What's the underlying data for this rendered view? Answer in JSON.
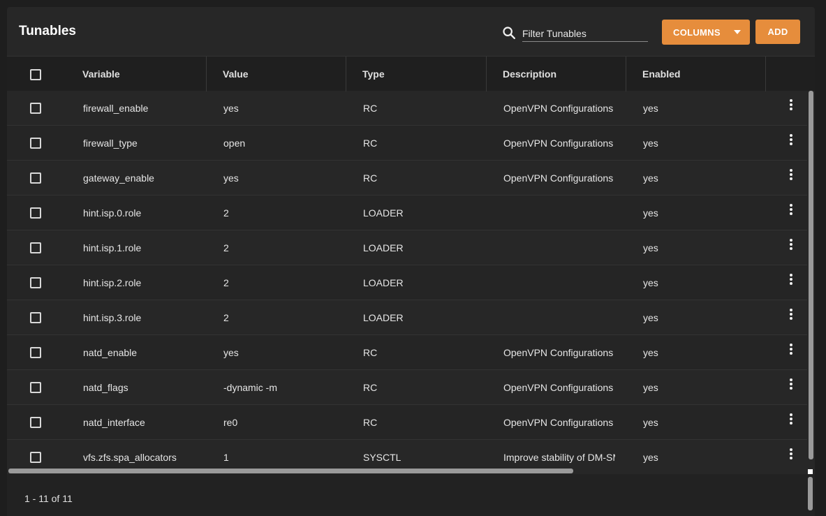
{
  "header": {
    "title": "Tunables",
    "search_placeholder": "Filter Tunables",
    "search_value": "",
    "columns_label": "COLUMNS",
    "add_label": "ADD"
  },
  "table": {
    "columns": [
      "Variable",
      "Value",
      "Type",
      "Description",
      "Enabled"
    ],
    "rows": [
      {
        "variable": "firewall_enable",
        "value": "yes",
        "type": "RC",
        "description": "OpenVPN Configurations",
        "enabled": "yes"
      },
      {
        "variable": "firewall_type",
        "value": "open",
        "type": "RC",
        "description": "OpenVPN Configurations",
        "enabled": "yes"
      },
      {
        "variable": "gateway_enable",
        "value": "yes",
        "type": "RC",
        "description": "OpenVPN Configurations",
        "enabled": "yes"
      },
      {
        "variable": "hint.isp.0.role",
        "value": "2",
        "type": "LOADER",
        "description": "",
        "enabled": "yes"
      },
      {
        "variable": "hint.isp.1.role",
        "value": "2",
        "type": "LOADER",
        "description": "",
        "enabled": "yes"
      },
      {
        "variable": "hint.isp.2.role",
        "value": "2",
        "type": "LOADER",
        "description": "",
        "enabled": "yes"
      },
      {
        "variable": "hint.isp.3.role",
        "value": "2",
        "type": "LOADER",
        "description": "",
        "enabled": "yes"
      },
      {
        "variable": "natd_enable",
        "value": "yes",
        "type": "RC",
        "description": "OpenVPN Configurations",
        "enabled": "yes"
      },
      {
        "variable": "natd_flags",
        "value": "-dynamic -m",
        "type": "RC",
        "description": "OpenVPN Configurations",
        "enabled": "yes"
      },
      {
        "variable": "natd_interface",
        "value": "re0",
        "type": "RC",
        "description": "OpenVPN Configurations",
        "enabled": "yes"
      },
      {
        "variable": "vfs.zfs.spa_allocators",
        "value": "1",
        "type": "SYSCTL",
        "description": "Improve stability of DM-SMR",
        "enabled": "yes"
      }
    ]
  },
  "footer": {
    "range_label": "1 - 11 of 11"
  },
  "icons": {
    "search": "search-icon",
    "columns_dropdown": "caret-down-icon",
    "row_actions": "more-vert-icon"
  },
  "colors": {
    "accent": "#e68d3c",
    "background": "#1e1e1e",
    "card": "#272727",
    "header_row": "#1f1f1f"
  }
}
